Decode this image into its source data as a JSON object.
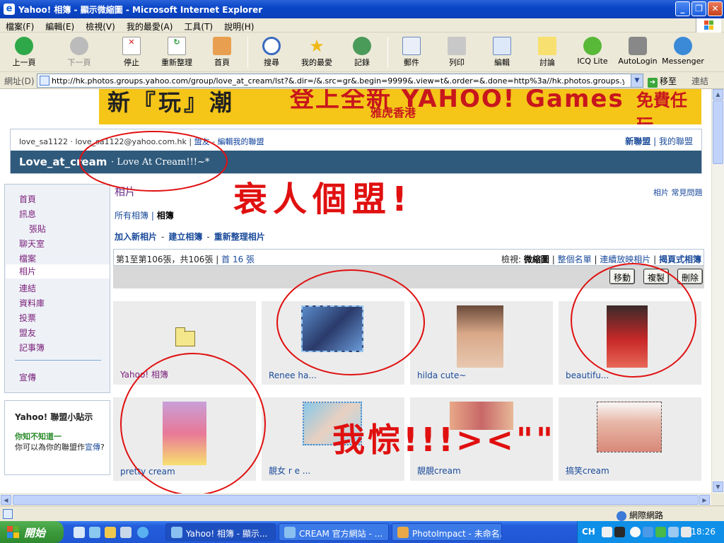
{
  "window": {
    "title": "Yahoo! 相簿 - 顯示微縮圖 - Microsoft Internet Explorer"
  },
  "menu": [
    "檔案(F)",
    "編輯(E)",
    "檢視(V)",
    "我的最愛(A)",
    "工具(T)",
    "說明(H)"
  ],
  "toolbar": {
    "back": "上一頁",
    "forward": "下一頁",
    "stop": "停止",
    "refresh": "重新整理",
    "home": "首頁",
    "search": "搜尋",
    "favorites": "我的最愛",
    "history": "記錄",
    "mail": "郵件",
    "print": "列印",
    "edit": "編輯",
    "discuss": "討論",
    "icq": "ICQ Lite",
    "autologin": "AutoLogin",
    "messenger": "Messenger"
  },
  "address": {
    "label": "網址(D)",
    "url": "http://hk.photos.groups.yahoo.com/group/love_at_cream/lst?&.dir=/&.src=gr&.begin=9999&.view=t&.order=&.done=http%3a//hk.photos.groups.yahoo.com/group/love_at_cre",
    "go": "移至",
    "links": "連結"
  },
  "banner": {
    "left": "新『玩』潮",
    "center": "登上全新 YAHOO! Games",
    "sub": "雅虎香港",
    "right": "免費任玩"
  },
  "group": {
    "user_id": "love_sa1122",
    "email": "love_sa1122@yahoo.com.hk",
    "member": "盟友",
    "edit_link": "編輯我的聯盟",
    "new_group": "新聯盟",
    "my_groups": "我的聯盟",
    "name": "Love_at_cream",
    "desc": "Love At Cream!!!~*"
  },
  "sidebar": {
    "items": [
      "首頁",
      "訊息",
      "張貼",
      "聊天室",
      "檔案",
      "相片",
      "連結",
      "資料庫",
      "投票",
      "盟友",
      "記事簿",
      "宣傳"
    ]
  },
  "tips": {
    "heading": "Yahoo! 聯盟小貼示",
    "question": "你知不知道一",
    "answer_prefix": "你可以為你的聯盟作",
    "answer_link": "宣傳",
    "answer_suffix": "?"
  },
  "main": {
    "heading": "相片",
    "faq": "相片 常見問題",
    "crumb_all": "所有相簿",
    "crumb_current": "相簿",
    "actions": [
      "加入新相片",
      "建立相簿",
      "重新整理相片"
    ],
    "range": "第1至第106張，共106張",
    "first": "首 16 張",
    "view_label": "檢視:",
    "view_current": "微縮圖",
    "view_list": "整個名單",
    "view_slideshow": "連續放映相片",
    "view_page": "揭頁式相簿",
    "btn_move": "移動",
    "btn_copy": "複製",
    "btn_delete": "刪除"
  },
  "tiles": [
    {
      "caption": "Yahoo! 相簿"
    },
    {
      "caption": "Renee ha..."
    },
    {
      "caption": "hilda cute~"
    },
    {
      "caption": "beautifu..."
    },
    {
      "caption": "pretty cream"
    },
    {
      "caption": "靚女 r e ..."
    },
    {
      "caption": "靚靚cream"
    },
    {
      "caption": "搞笑cream"
    }
  ],
  "annotations": {
    "text1": "衰人個盟!",
    "text2": "我悰!!!><\"\""
  },
  "status": {
    "zone": "網際網路"
  },
  "taskbar": {
    "start": "開始",
    "tasks": [
      "Yahoo! 相簿 - 顯示...",
      "CREAM 官方網站 - ...",
      "PhotoImpact - 未命名..."
    ],
    "lang": "CH",
    "clock": "18:26"
  },
  "colors": {
    "accent": "#2f5a7c",
    "link": "#1a4a9a",
    "annotation": "#e01010"
  }
}
